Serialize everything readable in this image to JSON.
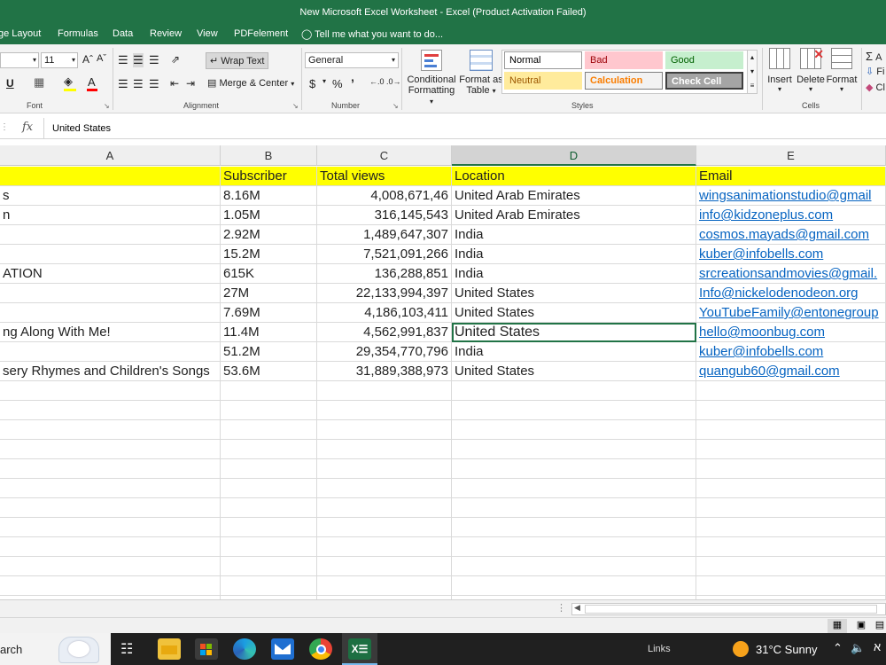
{
  "window": {
    "title": "New Microsoft Excel Worksheet - Excel (Product Activation Failed)"
  },
  "tabs": [
    "ge Layout",
    "Formulas",
    "Data",
    "Review",
    "View",
    "PDFelement"
  ],
  "tell_me": "Tell me what you want to do...",
  "ribbon": {
    "font_size": "11",
    "font_increase": "Aˆ",
    "font_decrease": "Aˇ",
    "underline": "U",
    "font_color": "A",
    "font_group": "Font",
    "wrap_text": "Wrap Text",
    "merge_center": "Merge & Center",
    "alignment_group": "Alignment",
    "number_format": "General",
    "currency": "$",
    "percent": "%",
    "comma": "’",
    "number_group": "Number",
    "conditional_formatting_1": "Conditional",
    "conditional_formatting_2": "Formatting",
    "format_as_table_1": "Format as",
    "format_as_table_2": "Table",
    "styles": [
      {
        "label": "Normal",
        "bg": "#ffffff",
        "fg": "#000000",
        "border": "#9a9a9a"
      },
      {
        "label": "Bad",
        "bg": "#ffc7ce",
        "fg": "#9c0006",
        "border": "#ffc7ce"
      },
      {
        "label": "Good",
        "bg": "#c6efce",
        "fg": "#006100",
        "border": "#c6efce"
      },
      {
        "label": "Neutral",
        "bg": "#ffeb9c",
        "fg": "#9c5700",
        "border": "#ffeb9c"
      },
      {
        "label": "Calculation",
        "bg": "#f2f2f2",
        "fg": "#fa7d00",
        "border": "#7f7f7f"
      },
      {
        "label": "Check Cell",
        "bg": "#a5a5a5",
        "fg": "#ffffff",
        "border": "#3f3f3f"
      }
    ],
    "styles_group": "Styles",
    "insert": "Insert",
    "delete": "Delete",
    "format": "Format",
    "cells_group": "Cells",
    "autosum_partial": "A",
    "fill_partial": "Fi",
    "clear_partial": "Cl"
  },
  "formula_bar": {
    "fx": "fx",
    "value": "United States"
  },
  "columns": [
    {
      "letter": "A",
      "selected": false
    },
    {
      "letter": "B",
      "selected": false
    },
    {
      "letter": "C",
      "selected": false
    },
    {
      "letter": "D",
      "selected": true
    },
    {
      "letter": "E",
      "selected": false
    }
  ],
  "header_row": [
    "",
    "Subscriber",
    "Total views",
    "Location",
    "Email"
  ],
  "rows": [
    [
      "s",
      "8.16M",
      "4,008,671,46",
      "United Arab Emirates",
      "wingsanimationstudio@gmail"
    ],
    [
      "n",
      "1.05M",
      "316,145,543",
      "United Arab Emirates",
      "info@kidzoneplus.com"
    ],
    [
      "",
      "2.92M",
      "1,489,647,307",
      "India",
      "cosmos.mayads@gmail.com"
    ],
    [
      "",
      "15.2M",
      "7,521,091,266",
      "India",
      "kuber@infobells.com"
    ],
    [
      "ATION",
      "615K",
      "136,288,851",
      "India",
      "srcreationsandmovies@gmail."
    ],
    [
      "",
      "27M",
      "22,133,994,397",
      "United States",
      "Info@nickelodenodeon.org"
    ],
    [
      "",
      "7.69M",
      "4,186,103,411",
      "United States",
      "YouTubeFamily@entonegroup"
    ],
    [
      "ng Along With Me!",
      "11.4M",
      "4,562,991,837",
      "United States",
      "hello@moonbug.com"
    ],
    [
      "",
      "51.2M",
      "29,354,770,796",
      "India",
      "kuber@infobells.com"
    ],
    [
      "sery Rhymes and Children's Songs",
      "53.6M",
      "31,889,388,973",
      "United States",
      "quangub60@gmail.com"
    ]
  ],
  "taskbar": {
    "search_partial": "arch",
    "links": "Links",
    "weather": "31°C  Sunny"
  }
}
